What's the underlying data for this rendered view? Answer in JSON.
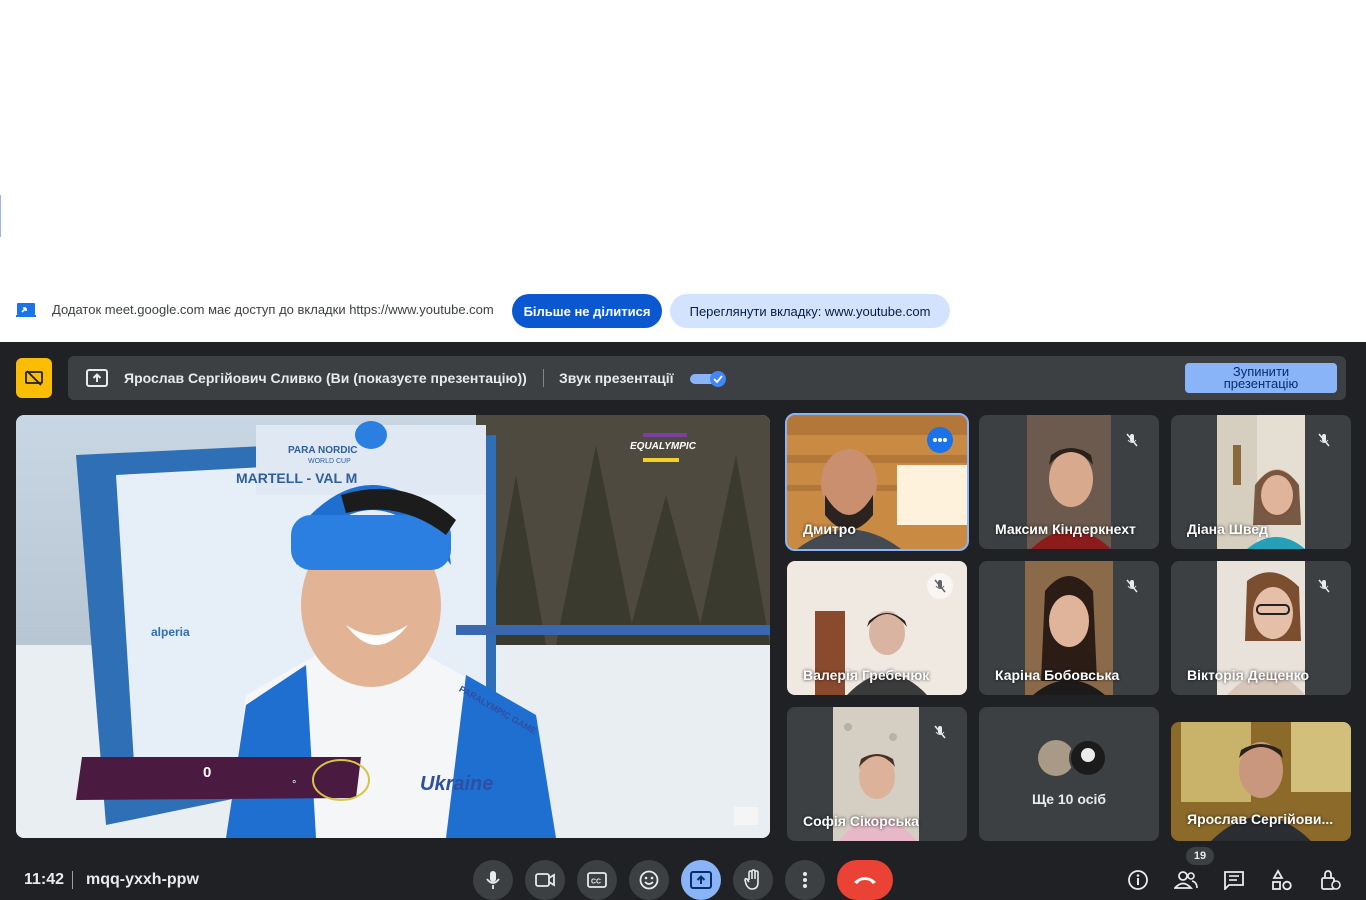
{
  "share_bar": {
    "text": "Додаток meet.google.com має доступ до вкладки https://www.youtube.com",
    "stop_sharing_label": "Більше не ділитися",
    "view_tab_label": "Переглянути вкладку: www.youtube.com"
  },
  "present_bar": {
    "presenter": "Ярослав Сергійович Сливко (Ви (показуєте презентацію))",
    "sound_label": "Звук презентації",
    "stop_label_line1": "Зупинити",
    "stop_label_line2": "презентацію"
  },
  "main_video": {
    "score_text": "0",
    "score_sub": "°",
    "brand_text": "EQUALYMPIC",
    "backdrop_lines": [
      "PARA NORDIC",
      "WORLD CUP",
      "MARTELL - VAL M"
    ],
    "sponsor_text": "alperia",
    "jacket_text": "Ukraine",
    "jacket_tag": "PARALYMPIC GAME"
  },
  "participants": [
    {
      "name": "Дмитро"
    },
    {
      "name": "Максим Кіндеркнехт"
    },
    {
      "name": "Діана Швед"
    },
    {
      "name": "Валерія Гребенюк"
    },
    {
      "name": "Каріна Бобовська"
    },
    {
      "name": "Вікторія Дещенко"
    },
    {
      "name": "Софія Сікорська"
    },
    {
      "name": "Ще 10 осіб"
    },
    {
      "name": "Ярослав Сергійови..."
    }
  ],
  "bottom_bar": {
    "time": "11:42",
    "meeting_code": "mqq-yxxh-ppw",
    "people_count": "19"
  },
  "colors": {
    "meet_bg": "#202124",
    "tile_bg": "#3c4043",
    "accent_blue": "#8ab4f8",
    "end_call_red": "#ea4335",
    "present_yellow": "#fbbc04",
    "share_btn_blue": "#0b57d0"
  },
  "icons": [
    "share-tab-icon",
    "presentation-icon",
    "mic-icon",
    "camera-icon",
    "captions-icon",
    "emoji-icon",
    "present-icon",
    "raise-hand-icon",
    "more-options-icon",
    "end-call-icon",
    "info-icon",
    "people-icon",
    "chat-icon",
    "activities-icon",
    "host-controls-icon",
    "mic-off-icon"
  ]
}
